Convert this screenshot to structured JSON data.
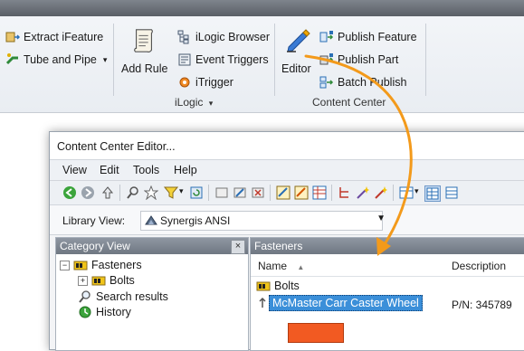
{
  "ribbon": {
    "tools_group": {
      "extract_ifeature": "Extract iFeature",
      "tube_and_pipe": "Tube and Pipe",
      "tube_dropdown": "▾"
    },
    "ilogic_group": {
      "add_rule": "Add Rule",
      "ilogic_browser": "iLogic Browser",
      "event_triggers": "Event Triggers",
      "itrigger": "iTrigger",
      "group_label": "iLogic",
      "group_label_arrow": "▾"
    },
    "content_center_group": {
      "editor": "Editor",
      "publish_feature": "Publish Feature",
      "publish_part": "Publish Part",
      "batch_publish": "Batch Publish",
      "group_label": "Content Center"
    }
  },
  "editor_window": {
    "title": "Content Center Editor...",
    "menu": [
      "View",
      "Edit",
      "Tools",
      "Help"
    ],
    "library_label": "Library View:",
    "library_value": "Synergis ANSI",
    "category_view": {
      "header": "Category View",
      "close": "×",
      "tree": [
        {
          "label": "Fasteners",
          "expander": "−",
          "icon": "folder-icon"
        },
        {
          "label": "Bolts",
          "expander": "+",
          "icon": "folder-icon"
        },
        {
          "label": "Search results",
          "icon": "search-icon"
        },
        {
          "label": "History",
          "icon": "history-icon"
        }
      ]
    },
    "main_view": {
      "header": "Fasteners",
      "columns": {
        "name": "Name",
        "sort_arrow": "▲",
        "description": "Description"
      },
      "rows": [
        {
          "name": "Bolts",
          "description": ""
        },
        {
          "name": "McMaster Carr Caster Wheel",
          "description": "P/N: 345789",
          "selected": true
        }
      ]
    }
  },
  "colors": {
    "accent_blue": "#3b8fd9",
    "callout_orange": "#f39a1b",
    "ribbon_bg": "#eef1f5"
  }
}
